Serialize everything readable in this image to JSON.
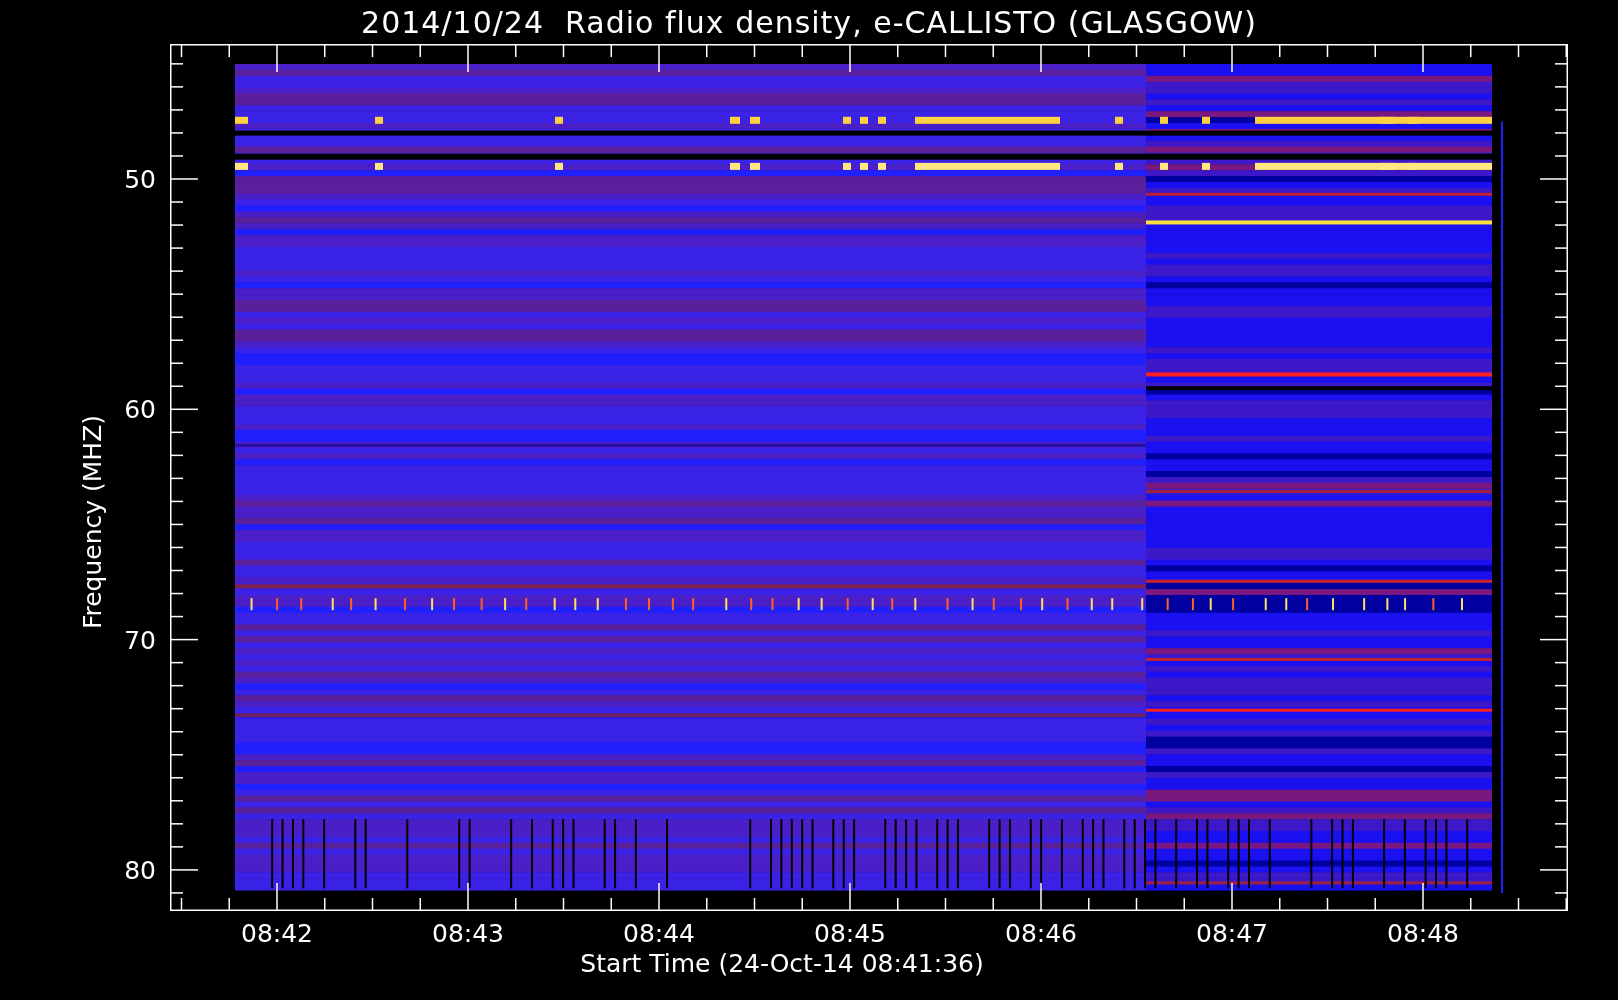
{
  "title": "2014/10/24  Radio flux density, e-CALLISTO (GLASGOW)",
  "y_axis": {
    "label": "Frequency (MHZ)",
    "ticks": [
      "50",
      "60",
      "70",
      "80"
    ]
  },
  "x_axis": {
    "label": "Start Time (24-Oct-14 08:41:36)",
    "ticks": [
      "08:42",
      "08:43",
      "08:44",
      "08:45",
      "08:46",
      "08:47",
      "08:48"
    ]
  }
}
